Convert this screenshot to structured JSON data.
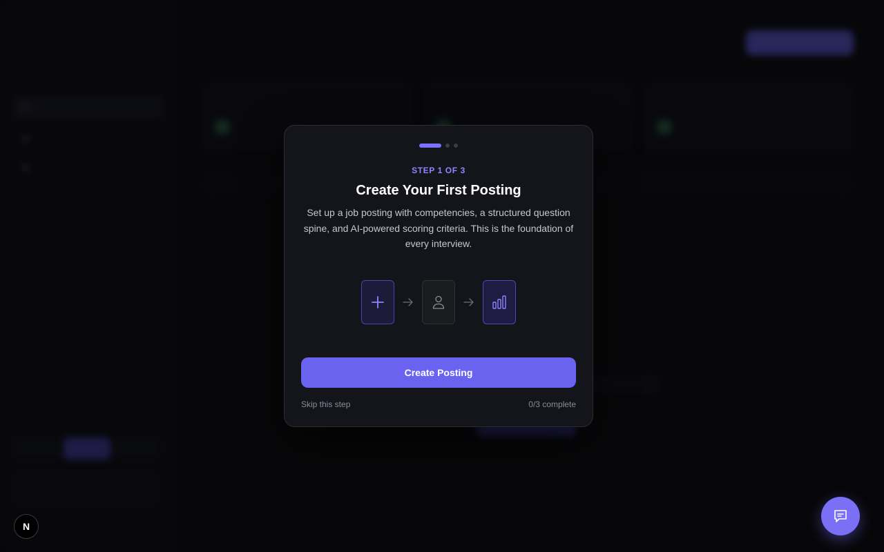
{
  "colors": {
    "accent": "#6a63f0",
    "accent_text": "#8d86ff",
    "modal_bg": "#14141b",
    "page_bg": "#0b0b0f"
  },
  "modal": {
    "step_label": "STEP 1 OF 3",
    "title": "Create Your First Posting",
    "description": "Set up a job posting with competencies, a structured question spine, and AI-powered scoring criteria. This is the foundation of every interview.",
    "visual_icons": [
      "plus-icon",
      "arrow-right-icon",
      "user-icon",
      "arrow-right-icon",
      "bar-chart-icon"
    ],
    "cta_label": "Create Posting",
    "skip_label": "Skip this step",
    "progress_text": "0/3 complete",
    "total_steps": 3,
    "current_step": 1
  },
  "floating": {
    "chat_icon": "chat-icon",
    "badge_text": "N"
  }
}
